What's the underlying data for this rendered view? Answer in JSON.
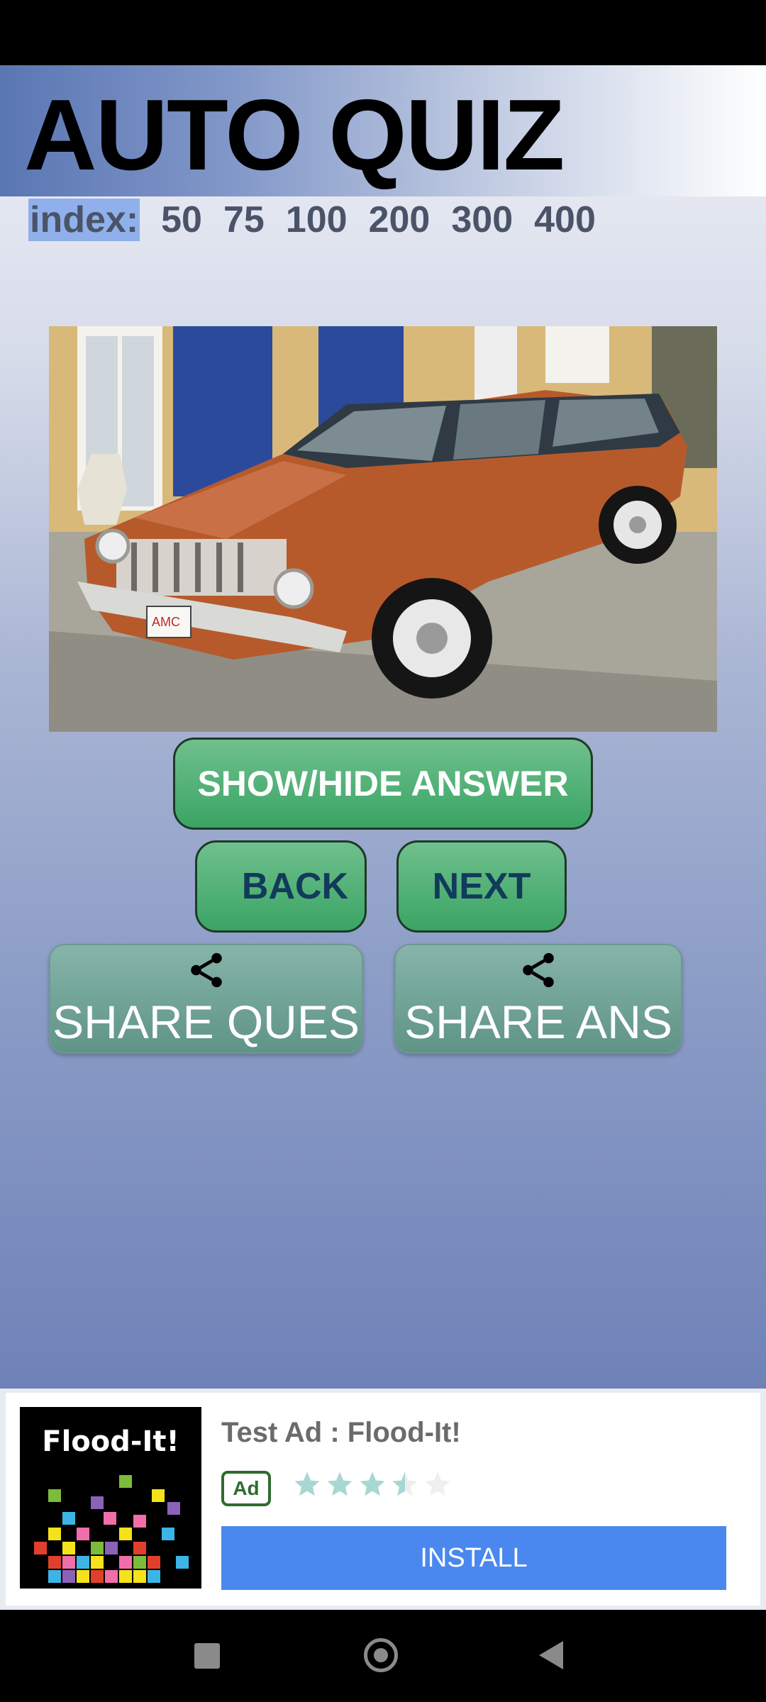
{
  "app": {
    "title": "AUTO QUIZ",
    "index_label": "index:",
    "index_links": [
      "50",
      "75",
      "100",
      "200",
      "300",
      "400"
    ]
  },
  "buttons": {
    "show_hide": "SHOW/HIDE ANSWER",
    "back": "BACK",
    "next": "NEXT",
    "share_question": "SHARE QUES",
    "share_answer": "SHARE ANS"
  },
  "image": {
    "plate_text": "AMC"
  },
  "ad": {
    "logo_text": "Flood-It!",
    "title": "Test Ad : Flood-It!",
    "badge": "Ad",
    "rating_stars": 3.5,
    "install_label": "INSTALL"
  },
  "colors": {
    "button_green": "#3aa464",
    "share_teal": "#5f9486",
    "install_blue": "#4a88ef",
    "index_highlight": "#8fb0ea"
  },
  "icons": {
    "share": "share-icon",
    "nav_recent": "recent-apps-icon",
    "nav_home": "home-icon",
    "nav_back": "back-icon"
  }
}
